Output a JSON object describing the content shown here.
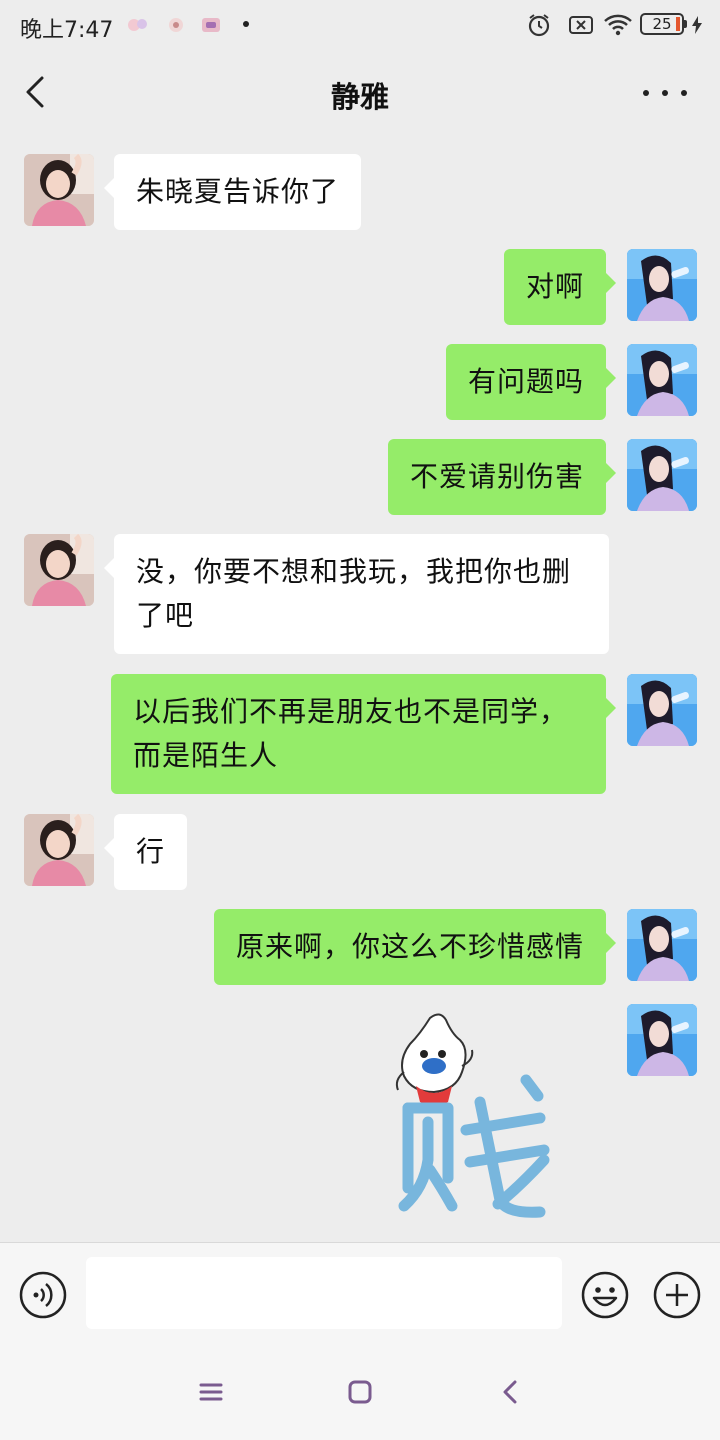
{
  "status_bar": {
    "time": "晚上7:47",
    "battery": "25",
    "icons": [
      "notification-icon",
      "notification-icon",
      "notification-icon",
      "alarm-icon",
      "sim-off-icon",
      "wifi-icon",
      "battery-icon",
      "charging-icon"
    ]
  },
  "header": {
    "title": "静雅",
    "back_icon": "chevron-left-icon",
    "more_icon": "more-dots-icon"
  },
  "messages": [
    {
      "sender": "peer",
      "text": "朱晓夏告诉你了"
    },
    {
      "sender": "self",
      "text": "对啊"
    },
    {
      "sender": "self",
      "text": "有问题吗"
    },
    {
      "sender": "self",
      "text": "不爱请别伤害"
    },
    {
      "sender": "peer",
      "text": "没，你要不想和我玩，我把你也删了吧"
    },
    {
      "sender": "self",
      "text": "以后我们不再是朋友也不是同学，而是陌生人"
    },
    {
      "sender": "peer",
      "text": "行"
    },
    {
      "sender": "self",
      "text": "原来啊，你这么不珍惜感情"
    },
    {
      "sender": "self",
      "sticker": "贱"
    }
  ],
  "input_bar": {
    "value": "",
    "icons": [
      "voice-icon",
      "emoji-icon",
      "plus-icon"
    ]
  },
  "nav_bar": {
    "icons": [
      "menu-icon",
      "home-icon",
      "back-icon"
    ]
  },
  "colors": {
    "background": "#ededed",
    "self_bubble": "#95ec69",
    "peer_bubble": "#ffffff",
    "battery_low": "#e4572e"
  }
}
